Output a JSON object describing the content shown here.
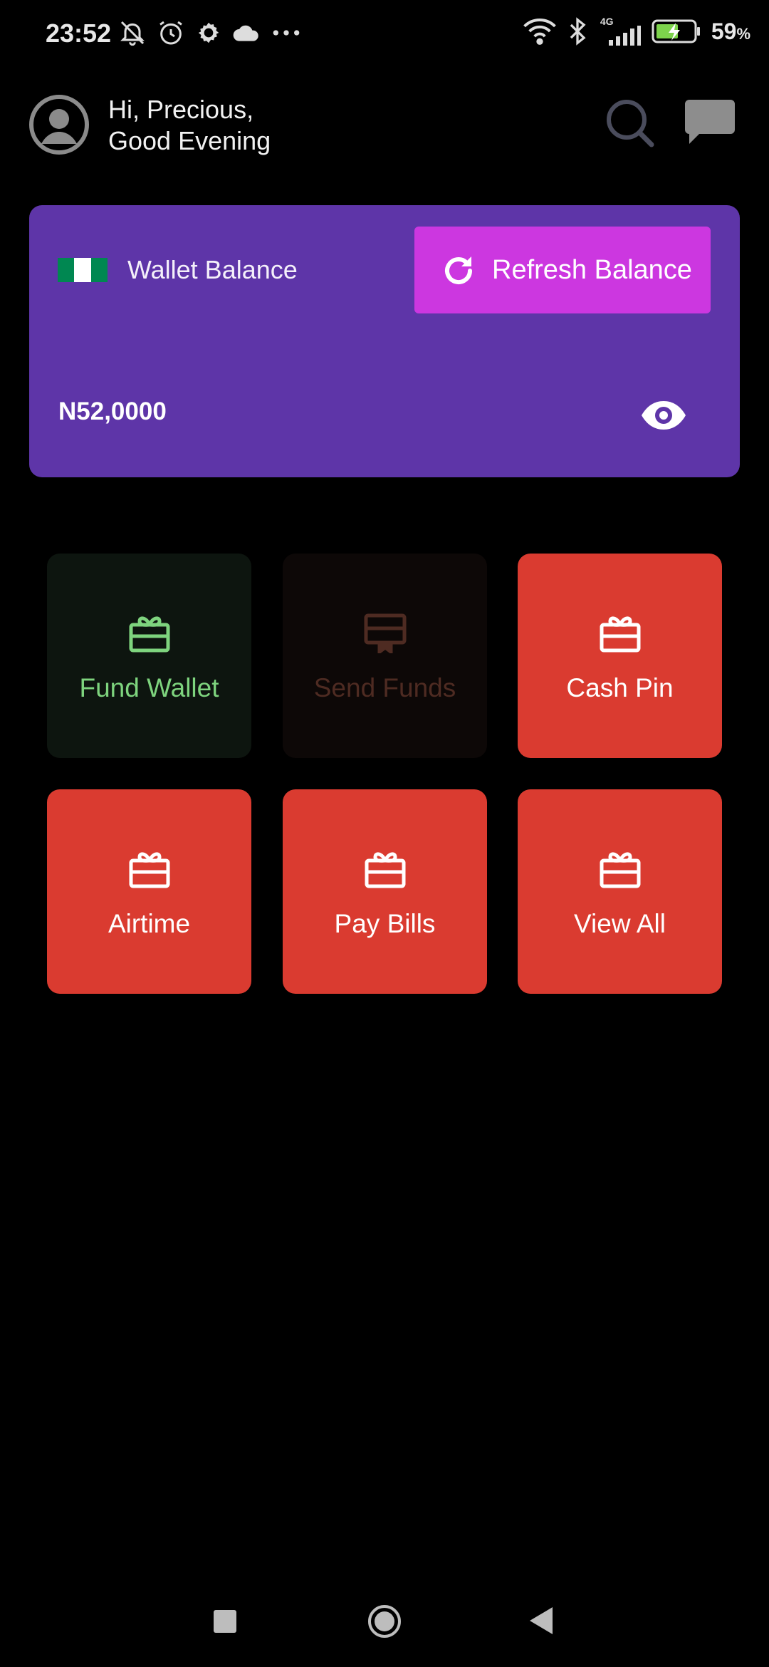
{
  "status_bar": {
    "time": "23:52",
    "left_icons": [
      "muted-bell-icon",
      "alarm-icon",
      "settings-icon",
      "cloud-icon",
      "more-dots-icon"
    ],
    "right_icons": [
      "wifi-icon",
      "bluetooth-icon",
      "signal-4g-icon",
      "battery-charging-icon"
    ],
    "network_label": "4G",
    "battery_percent": "59",
    "battery_unit": "%"
  },
  "header": {
    "greeting_line1": "Hi, Precious,",
    "greeting_line2": "Good Evening",
    "icons": [
      "avatar-icon",
      "search-icon",
      "chat-icon"
    ]
  },
  "wallet": {
    "label": "Wallet Balance",
    "refresh_label": "Refresh Balance",
    "balance": "N52,0000",
    "flag_colors": [
      "#008751",
      "#ffffff",
      "#008751"
    ],
    "card_color": "#5e35a8",
    "refresh_color": "#cc37e0"
  },
  "tiles": [
    {
      "label": "Fund Wallet",
      "icon": "gift-card-icon"
    },
    {
      "label": "Send Funds",
      "icon": "certificate-icon"
    },
    {
      "label": "Cash Pin",
      "icon": "gift-card-icon"
    },
    {
      "label": "Airtime",
      "icon": "gift-card-icon"
    },
    {
      "label": "Pay Bills",
      "icon": "gift-card-icon"
    },
    {
      "label": "View All",
      "icon": "gift-card-icon"
    }
  ],
  "colors": {
    "tile_red": "#da3b30",
    "fund_green": "#7ed47e",
    "send_brown": "#4e2b22"
  }
}
